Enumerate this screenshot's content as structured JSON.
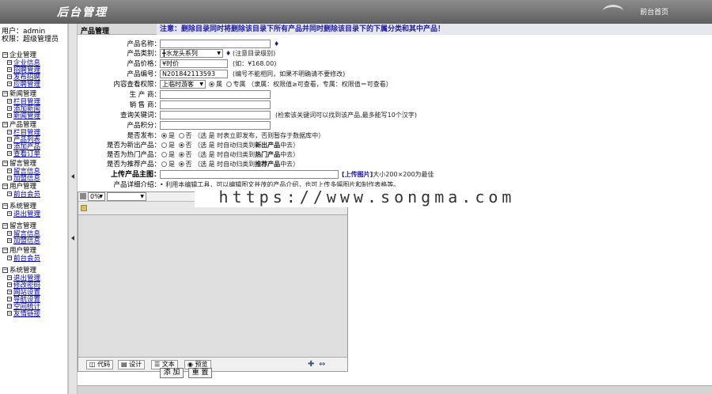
{
  "header": {
    "logo": "后台管理",
    "home": "前台首页"
  },
  "user": {
    "name_line": "用户：admin",
    "role_line": "权限：超级管理员"
  },
  "sidebar": {
    "groups": [
      {
        "label": "企业管理",
        "items": [
          "企业信息",
          "招聘管理",
          "发布招聘",
          "应聘管理"
        ]
      },
      {
        "label": "新闻管理",
        "items": [
          "栏目管理",
          "添加新闻",
          "新闻管理"
        ]
      },
      {
        "label": "产品管理",
        "items": [
          "栏目管理",
          "产品列表",
          "添加产品",
          "查看订单"
        ]
      },
      {
        "label": "留言管理",
        "items": [
          "留言信息",
          "加盟信息"
        ]
      },
      {
        "label": "用户管理",
        "items": [
          "前台会员"
        ]
      },
      {
        "label": "系统管理",
        "items": [
          "退出管理"
        ]
      },
      {
        "label": "留言管理",
        "items": [
          "留言信息",
          "加盟信息"
        ]
      },
      {
        "label": "用户管理",
        "items": [
          "前台会员"
        ]
      },
      {
        "label": "系统管理",
        "items": [
          "退出管理",
          "修改密码",
          "网站设置",
          "导航设置",
          "空间统计",
          "友情链接"
        ]
      }
    ]
  },
  "main": {
    "title": "产品管理",
    "notice": "注意：删除目录同时将删除该目录下所有产品并同时删除该目录下的下属分类和其中产品！",
    "fields": {
      "name_label": "产品名称：",
      "category_label": "产品类别：",
      "category_value": "╋水龙头系列",
      "category_note": "(注意目录级别)",
      "price_label": "产品价格：",
      "price_value": "¥时价",
      "price_note": "(如：¥168.00)",
      "code_label": "产品编号：",
      "code_value": "N201842113593",
      "code_note": "(编号不能相同，如果不明确请不要修改)",
      "perm_label": "内容查看权限：",
      "perm_value": "上临时游客",
      "perm_opt1": "属",
      "perm_opt2": "专属",
      "perm_note": "（隶属：权限值≥可查看，专属：权限值＝可查看）",
      "maker_label": "生 产 商：",
      "seller_label": "销 售 商：",
      "keyword_label": "查询关键词：",
      "keyword_note": "(检索该关键词可以找到该产品,最多能写10个汉字)",
      "score_label": "产品积分：",
      "publish_label": "是否发布：",
      "publish_note": "（选 是 时表立即发布，否则暂存于数据库中）",
      "new_label": "是否为新出产品：",
      "new_note_a": "（选 是 时自动归类到",
      "new_note_b": "新出产品",
      "new_note_c": "中去）",
      "hot_label": "是否为热门产品：",
      "hot_note_b": "热门产品",
      "rec_label": "是否为推荐产品：",
      "rec_note_b": "推荐产品",
      "yes": "是",
      "no": "否",
      "image_label": "上传产品主图：",
      "upload_link": "[上传图片]",
      "upload_note": "大小200×200为最佳",
      "detail_label": "产品详细介绍：",
      "detail_note": "利用本编辑工具，可以编辑图文并茂的产品介绍，也可上传多幅图片和制作表格等。"
    },
    "editor": {
      "zoom": "0%",
      "tabs": [
        "代码",
        "设计",
        "文本",
        "预览"
      ]
    },
    "buttons": {
      "add": "添 加",
      "reset": "重 置"
    }
  },
  "watermark": "https://www.songma.com"
}
